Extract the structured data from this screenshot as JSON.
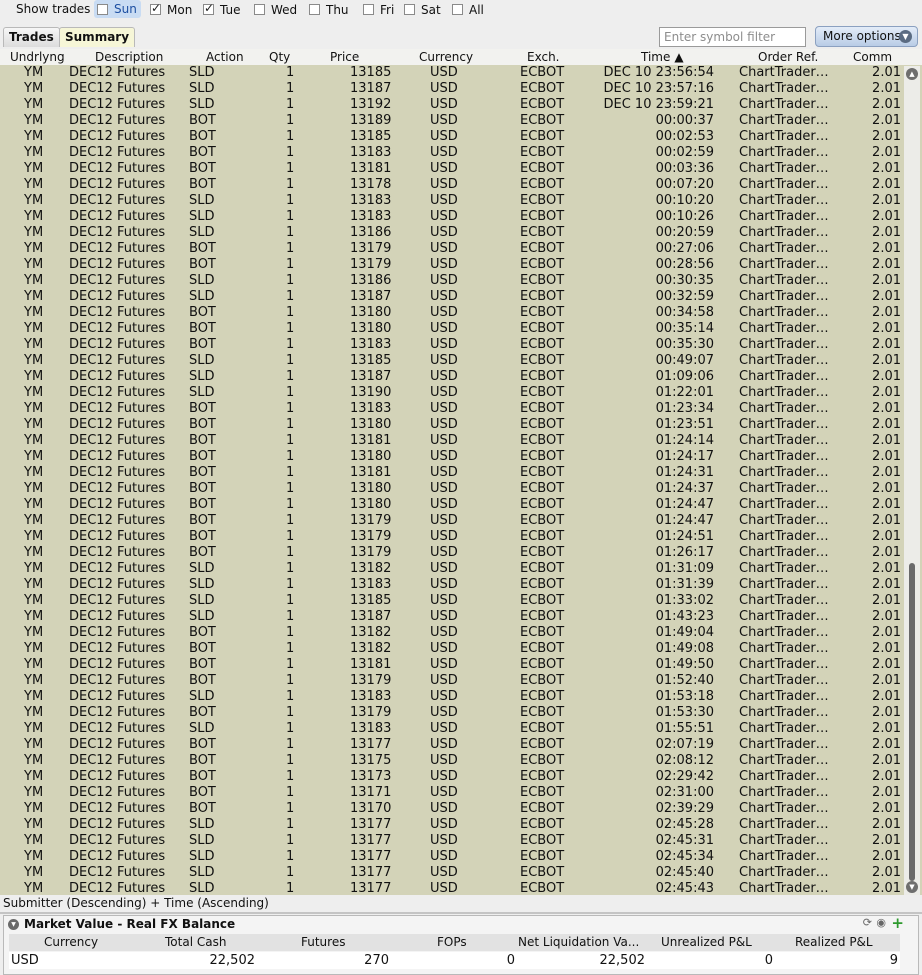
{
  "toolbar": {
    "show_trades_label": "Show trades",
    "days": [
      {
        "label": "Sun",
        "checked": false,
        "active": true
      },
      {
        "label": "Mon",
        "checked": true,
        "active": false
      },
      {
        "label": "Tue",
        "checked": true,
        "active": false
      },
      {
        "label": "Wed",
        "checked": false,
        "active": false
      },
      {
        "label": "Thu",
        "checked": false,
        "active": false
      },
      {
        "label": "Fri",
        "checked": false,
        "active": false
      },
      {
        "label": "Sat",
        "checked": false,
        "active": false
      },
      {
        "label": "All",
        "checked": false,
        "active": false
      }
    ]
  },
  "tabs": [
    {
      "label": "Trades",
      "selected": false
    },
    {
      "label": "Summary",
      "selected": true
    }
  ],
  "search": {
    "placeholder": "Enter symbol filter"
  },
  "more_options_label": "More options",
  "columns": {
    "underlying": "Undrlyng",
    "description": "Description",
    "action": "Action",
    "qty": "Qty",
    "price": "Price",
    "currency": "Currency",
    "exchange": "Exch.",
    "time": "Time",
    "order_ref": "Order Ref.",
    "comm": "Comm"
  },
  "trade_defaults": {
    "underlying": "YM",
    "description": "DEC12 Futures",
    "qty": "1",
    "currency": "USD",
    "exchange": "ECBOT",
    "order_ref": "ChartTrader…",
    "comm": "2.01"
  },
  "trades": [
    [
      "SLD",
      "13185",
      "DEC 10 23:56:54"
    ],
    [
      "SLD",
      "13187",
      "DEC 10 23:57:16"
    ],
    [
      "SLD",
      "13192",
      "DEC 10 23:59:21"
    ],
    [
      "BOT",
      "13189",
      "00:00:37"
    ],
    [
      "BOT",
      "13185",
      "00:02:53"
    ],
    [
      "BOT",
      "13183",
      "00:02:59"
    ],
    [
      "BOT",
      "13181",
      "00:03:36"
    ],
    [
      "BOT",
      "13178",
      "00:07:20"
    ],
    [
      "SLD",
      "13183",
      "00:10:20"
    ],
    [
      "SLD",
      "13183",
      "00:10:26"
    ],
    [
      "SLD",
      "13186",
      "00:20:59"
    ],
    [
      "BOT",
      "13179",
      "00:27:06"
    ],
    [
      "BOT",
      "13179",
      "00:28:56"
    ],
    [
      "SLD",
      "13186",
      "00:30:35"
    ],
    [
      "SLD",
      "13187",
      "00:32:59"
    ],
    [
      "BOT",
      "13180",
      "00:34:58"
    ],
    [
      "BOT",
      "13180",
      "00:35:14"
    ],
    [
      "BOT",
      "13183",
      "00:35:30"
    ],
    [
      "SLD",
      "13185",
      "00:49:07"
    ],
    [
      "SLD",
      "13187",
      "01:09:06"
    ],
    [
      "SLD",
      "13190",
      "01:22:01"
    ],
    [
      "BOT",
      "13183",
      "01:23:34"
    ],
    [
      "BOT",
      "13180",
      "01:23:51"
    ],
    [
      "BOT",
      "13181",
      "01:24:14"
    ],
    [
      "BOT",
      "13180",
      "01:24:17"
    ],
    [
      "BOT",
      "13181",
      "01:24:31"
    ],
    [
      "BOT",
      "13180",
      "01:24:37"
    ],
    [
      "BOT",
      "13180",
      "01:24:47"
    ],
    [
      "BOT",
      "13179",
      "01:24:47"
    ],
    [
      "BOT",
      "13179",
      "01:24:51"
    ],
    [
      "BOT",
      "13179",
      "01:26:17"
    ],
    [
      "SLD",
      "13182",
      "01:31:09"
    ],
    [
      "SLD",
      "13183",
      "01:31:39"
    ],
    [
      "SLD",
      "13185",
      "01:33:02"
    ],
    [
      "SLD",
      "13187",
      "01:43:23"
    ],
    [
      "BOT",
      "13182",
      "01:49:04"
    ],
    [
      "BOT",
      "13182",
      "01:49:08"
    ],
    [
      "BOT",
      "13181",
      "01:49:50"
    ],
    [
      "BOT",
      "13179",
      "01:52:40"
    ],
    [
      "SLD",
      "13183",
      "01:53:18"
    ],
    [
      "BOT",
      "13179",
      "01:53:30"
    ],
    [
      "SLD",
      "13183",
      "01:55:51"
    ],
    [
      "BOT",
      "13177",
      "02:07:19"
    ],
    [
      "BOT",
      "13175",
      "02:08:12"
    ],
    [
      "BOT",
      "13173",
      "02:29:42"
    ],
    [
      "BOT",
      "13171",
      "02:31:00"
    ],
    [
      "BOT",
      "13170",
      "02:39:29"
    ],
    [
      "SLD",
      "13177",
      "02:45:28"
    ],
    [
      "SLD",
      "13177",
      "02:45:31"
    ],
    [
      "SLD",
      "13177",
      "02:45:34"
    ],
    [
      "SLD",
      "13177",
      "02:45:40"
    ],
    [
      "SLD",
      "13177",
      "02:45:43"
    ]
  ],
  "sort_description": "Submitter (Descending) + Time (Ascending)",
  "market_value": {
    "title": "Market Value - Real FX Balance",
    "headers": [
      "Currency",
      "Total Cash",
      "Futures",
      "FOPs",
      "Net Liquidation Va...",
      "Unrealized P&L",
      "Realized P&L"
    ],
    "row": [
      "USD",
      "22,502",
      "270",
      "0",
      "22,502",
      "0",
      "9"
    ]
  }
}
